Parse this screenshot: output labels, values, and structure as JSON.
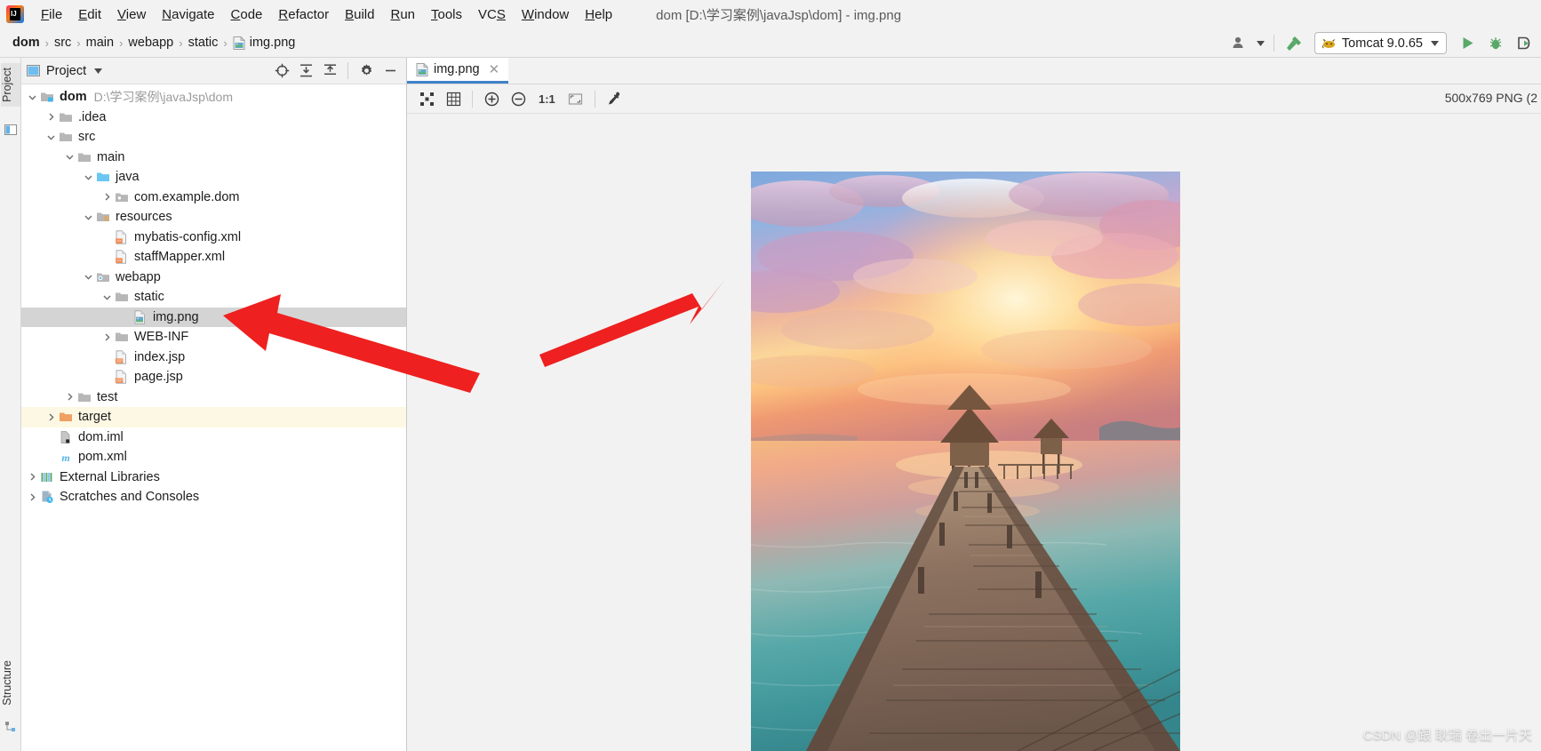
{
  "window": {
    "title": "dom [D:\\学习案例\\javaJsp\\dom] - img.png",
    "app_icon": "intellij-idea-logo"
  },
  "menubar": {
    "items": [
      {
        "label": "File",
        "mnemonic": "F"
      },
      {
        "label": "Edit",
        "mnemonic": "E"
      },
      {
        "label": "View",
        "mnemonic": "V"
      },
      {
        "label": "Navigate",
        "mnemonic": "N"
      },
      {
        "label": "Code",
        "mnemonic": "C"
      },
      {
        "label": "Refactor",
        "mnemonic": "R"
      },
      {
        "label": "Build",
        "mnemonic": "B"
      },
      {
        "label": "Run",
        "mnemonic": "R"
      },
      {
        "label": "Tools",
        "mnemonic": "T"
      },
      {
        "label": "VCS",
        "mnemonic": "S"
      },
      {
        "label": "Window",
        "mnemonic": "W"
      },
      {
        "label": "Help",
        "mnemonic": "H"
      }
    ]
  },
  "breadcrumb": {
    "items": [
      "dom",
      "src",
      "main",
      "webapp",
      "static",
      "img.png"
    ],
    "separator": "›",
    "file_icon": "png-image-file-icon"
  },
  "toolbar": {
    "account_icon": "user-account-icon",
    "account_dropdown_icon": "chevron-down-icon",
    "update_icon": "hammer-build-icon",
    "run_config": {
      "icon": "tomcat-cat-icon",
      "label": "Tomcat 9.0.65",
      "dropdown_icon": "chevron-down-icon"
    },
    "run_icon": "run-play-icon",
    "debug_icon": "debug-bug-icon",
    "coverage_icon": "run-with-coverage-icon"
  },
  "left_strips": {
    "project_tab": "Project",
    "project_tab_icon": "project-panel-icon",
    "structure_tab": "Structure",
    "structure_tab_icon": "structure-panel-icon"
  },
  "project_panel": {
    "header": {
      "icon": "project-view-icon",
      "title": "Project",
      "dropdown_icon": "chevron-down-icon",
      "locate_icon": "scroll-from-source-icon",
      "expand_icon": "expand-all-icon",
      "collapse_icon": "collapse-all-icon",
      "settings_icon": "gear-icon",
      "hide_icon": "hide-panel-icon"
    },
    "tree": [
      {
        "label": "dom",
        "path": "D:\\学习案例\\javaJsp\\dom",
        "indent": 0,
        "chevron": "expanded",
        "icon": "module-folder-icon",
        "bold": true,
        "state": "normal"
      },
      {
        "label": ".idea",
        "path": "",
        "indent": 1,
        "chevron": "collapsed",
        "icon": "folder-icon",
        "bold": false,
        "state": "normal"
      },
      {
        "label": "src",
        "path": "",
        "indent": 1,
        "chevron": "expanded",
        "icon": "folder-icon",
        "bold": false,
        "state": "normal"
      },
      {
        "label": "main",
        "path": "",
        "indent": 2,
        "chevron": "expanded",
        "icon": "folder-icon",
        "bold": false,
        "state": "normal"
      },
      {
        "label": "java",
        "path": "",
        "indent": 3,
        "chevron": "expanded",
        "icon": "source-folder-icon",
        "bold": false,
        "state": "normal"
      },
      {
        "label": "com.example.dom",
        "path": "",
        "indent": 4,
        "chevron": "collapsed",
        "icon": "package-folder-icon",
        "bold": false,
        "state": "normal"
      },
      {
        "label": "resources",
        "path": "",
        "indent": 3,
        "chevron": "expanded",
        "icon": "resources-folder-icon",
        "bold": false,
        "state": "normal"
      },
      {
        "label": "mybatis-config.xml",
        "path": "",
        "indent": 4,
        "chevron": "none",
        "icon": "xml-file-icon",
        "bold": false,
        "state": "normal"
      },
      {
        "label": "staffMapper.xml",
        "path": "",
        "indent": 4,
        "chevron": "none",
        "icon": "xml-file-icon",
        "bold": false,
        "state": "normal"
      },
      {
        "label": "webapp",
        "path": "",
        "indent": 3,
        "chevron": "expanded",
        "icon": "web-folder-icon",
        "bold": false,
        "state": "normal"
      },
      {
        "label": "static",
        "path": "",
        "indent": 4,
        "chevron": "expanded",
        "icon": "folder-icon",
        "bold": false,
        "state": "normal"
      },
      {
        "label": "img.png",
        "path": "",
        "indent": 5,
        "chevron": "none",
        "icon": "png-image-file-icon",
        "bold": false,
        "state": "selected"
      },
      {
        "label": "WEB-INF",
        "path": "",
        "indent": 4,
        "chevron": "collapsed",
        "icon": "folder-icon",
        "bold": false,
        "state": "normal"
      },
      {
        "label": "index.jsp",
        "path": "",
        "indent": 4,
        "chevron": "none",
        "icon": "jsp-file-icon",
        "bold": false,
        "state": "normal"
      },
      {
        "label": "page.jsp",
        "path": "",
        "indent": 4,
        "chevron": "none",
        "icon": "jsp-file-icon",
        "bold": false,
        "state": "normal"
      },
      {
        "label": "test",
        "path": "",
        "indent": 2,
        "chevron": "collapsed",
        "icon": "folder-icon",
        "bold": false,
        "state": "normal"
      },
      {
        "label": "target",
        "path": "",
        "indent": 1,
        "chevron": "collapsed",
        "icon": "excluded-folder-icon",
        "bold": false,
        "state": "highlight"
      },
      {
        "label": "dom.iml",
        "path": "",
        "indent": 1,
        "chevron": "none",
        "icon": "iml-module-file-icon",
        "bold": false,
        "state": "normal"
      },
      {
        "label": "pom.xml",
        "path": "",
        "indent": 1,
        "chevron": "none",
        "icon": "maven-pom-icon",
        "bold": false,
        "state": "normal"
      },
      {
        "label": "External Libraries",
        "path": "",
        "indent": 0,
        "chevron": "collapsed",
        "icon": "external-libraries-icon",
        "bold": false,
        "state": "normal"
      },
      {
        "label": "Scratches and Consoles",
        "path": "",
        "indent": 0,
        "chevron": "collapsed",
        "icon": "scratches-icon",
        "bold": false,
        "state": "normal"
      }
    ]
  },
  "editor": {
    "tab": {
      "label": "img.png",
      "icon": "png-image-file-icon",
      "close_icon": "close-icon"
    },
    "image_toolbar": {
      "transparency_icon": "toggle-transparency-chessboard-icon",
      "grid_icon": "toggle-grid-icon",
      "zoom_in_icon": "zoom-in-icon",
      "zoom_out_icon": "zoom-out-icon",
      "actual_size_label": "1:1",
      "fit_icon": "fit-to-window-icon",
      "color_picker_icon": "eyedropper-color-picker-icon"
    },
    "image_info": "500x769 PNG (2"
  },
  "annotations": {
    "arrow_to_file": "red-arrow-pointing-to-img-png-tree-node",
    "arrow_to_image": "red-arrow-pointing-to-image-preview",
    "arrow_color": "#ee2020"
  },
  "watermark": {
    "text": "CSDN @跟 耿瑞 卷出一片天"
  },
  "colors": {
    "panel_bg": "#f2f2f2",
    "tree_bg": "#ffffff",
    "selection": "#d4d4d4",
    "highlight_row": "#fdf8e3",
    "tab_underline": "#4083c9",
    "accent_green": "#59a869",
    "arrow_red": "#ee2020"
  }
}
